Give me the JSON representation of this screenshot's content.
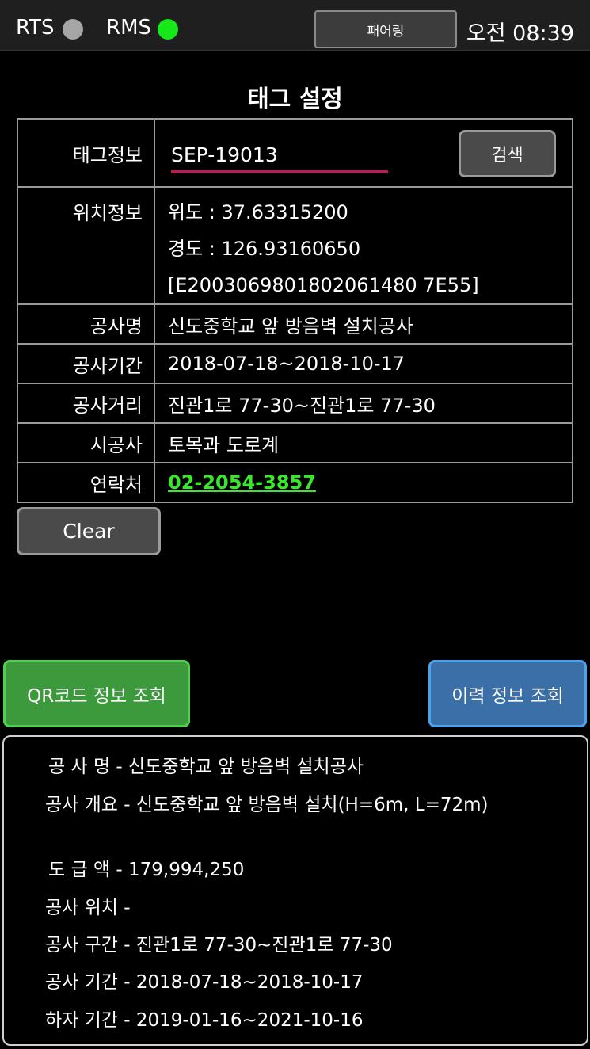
{
  "status": {
    "rts_label": "RTS",
    "rts_color": "#a6a6a6",
    "rms_label": "RMS",
    "rms_color": "#16e81a",
    "pair_button": "패어링",
    "clock": "오전 08:39"
  },
  "title": "태그 설정",
  "table": {
    "tag_label": "태그정보",
    "tag_value": "SEP-19013",
    "search_button": "검색",
    "location_label": "위치정보",
    "latitude": "위도 : 37.63315200",
    "longitude": "경도 : 126.93160650",
    "epc": "[E2003069801802061480 7E55]",
    "rows": [
      {
        "label": "공사명",
        "value": "신도중학교 앞 방음벽 설치공사"
      },
      {
        "label": "공사기간",
        "value": "2018-07-18~2018-10-17"
      },
      {
        "label": "공사거리",
        "value": "진관1로 77-30~진관1로 77-30"
      },
      {
        "label": "시공사",
        "value": "토목과 도로계"
      }
    ],
    "contact_label": "연락처",
    "contact_value": "02-2054-3857"
  },
  "clear_button": "Clear",
  "qr_button": "QR코드 정보 조회",
  "history_button": "이력 정보 조회",
  "info": {
    "name": "공 사 명 - 신도중학교 앞 방음벽 설치공사",
    "overview": "공사 개요 - 신도중학교 앞 방음벽 설치(H=6m, L=72m)",
    "amount": "도 급 액 - 179,994,250",
    "location": "공사 위치 -",
    "section": "공사 구간 - 진관1로 77-30~진관1로 77-30",
    "period": "공사 기간 - 2018-07-18~2018-10-17",
    "warranty": "하자 기간 - 2019-01-16~2021-10-16"
  }
}
